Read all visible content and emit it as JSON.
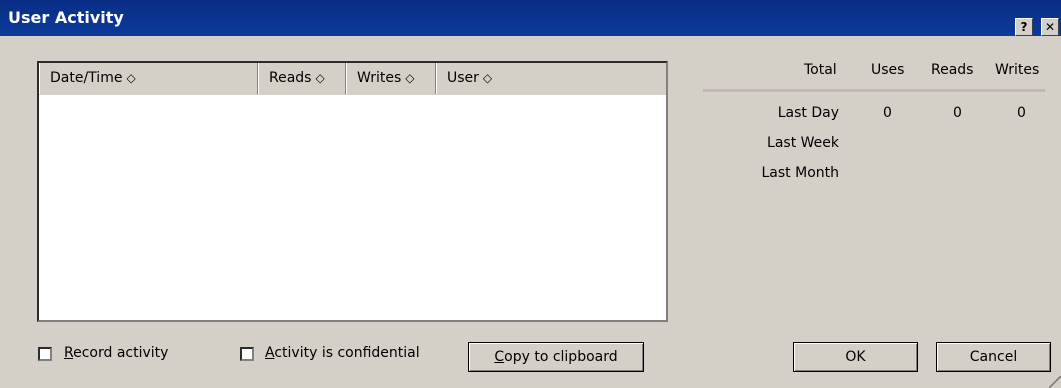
{
  "window": {
    "title": "User Activity",
    "help_glyph": "?",
    "close_glyph": "✕"
  },
  "list": {
    "columns": [
      {
        "label": "Date/Time",
        "sort_glyph": "◇"
      },
      {
        "label": "Reads",
        "sort_glyph": "◇"
      },
      {
        "label": "Writes",
        "sort_glyph": "◇"
      },
      {
        "label": "User",
        "sort_glyph": "◇"
      }
    ],
    "rows": []
  },
  "stats": {
    "headers": [
      "Total",
      "Uses",
      "Reads",
      "Writes"
    ],
    "rows": [
      {
        "label": "Last Day",
        "uses": "0",
        "reads": "0",
        "writes": "0"
      },
      {
        "label": "Last Week",
        "uses": "",
        "reads": "",
        "writes": ""
      },
      {
        "label": "Last Month",
        "uses": "",
        "reads": "",
        "writes": ""
      }
    ]
  },
  "options": {
    "record_activity": {
      "label_underlined": "R",
      "label_rest": "ecord activity",
      "checked": false
    },
    "confidential": {
      "label_underlined": "A",
      "label_rest": "ctivity is confidential",
      "checked": false
    }
  },
  "buttons": {
    "copy": {
      "label_underlined": "C",
      "label_rest": "opy to clipboard"
    },
    "ok": "OK",
    "cancel": "Cancel"
  }
}
